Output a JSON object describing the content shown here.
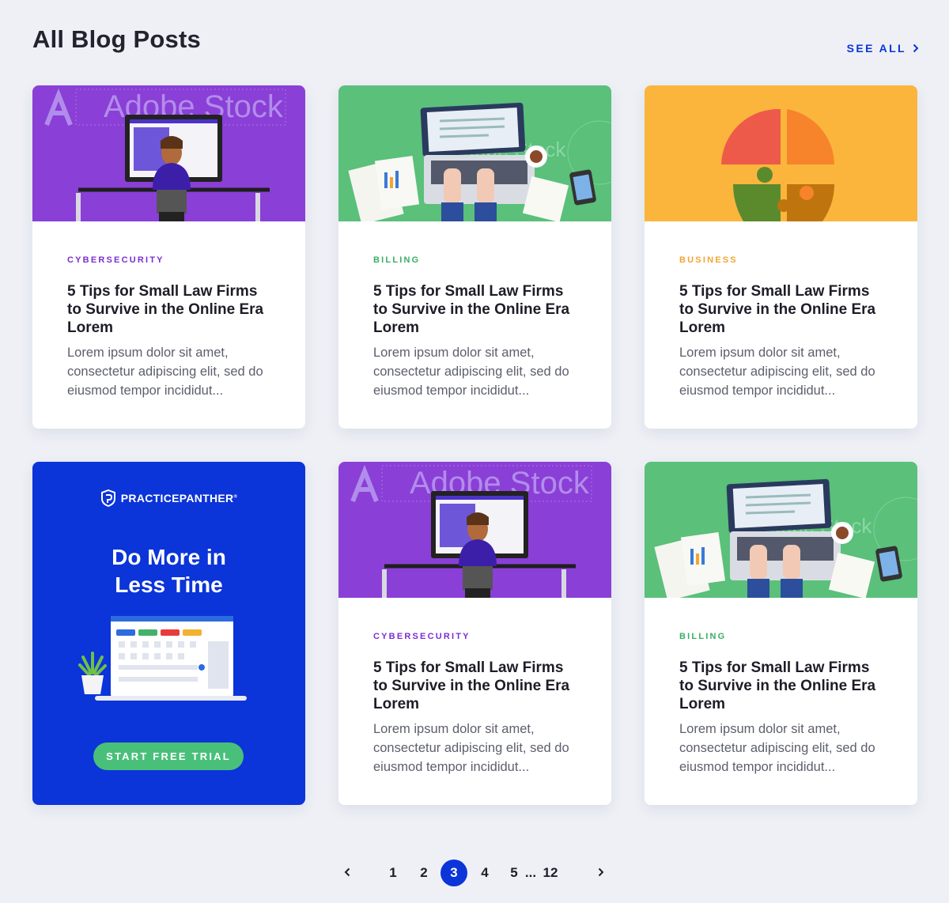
{
  "header": {
    "title": "All Blog Posts",
    "see_all": "SEE ALL"
  },
  "colors": {
    "accent_blue": "#0b34d9",
    "cybersecurity": "#7b2fd0",
    "billing": "#3aaf66",
    "business": "#f2a531",
    "cta_green": "#49c07a"
  },
  "posts": [
    {
      "category": "CYBERSECURITY",
      "title": "5 Tips for Small Law Firms to Survive in the Online Era Lorem",
      "excerpt": "Lorem ipsum dolor sit amet, consectetur adipiscing elit, sed do eiusmod tempor incididut...",
      "image": "person-at-computer-illustration",
      "watermark": "Adobe Stock"
    },
    {
      "category": "BILLING",
      "title": "5 Tips for Small Law Firms to Survive in the Online Era Lorem",
      "excerpt": "Lorem ipsum dolor sit amet, consectetur adipiscing elit, sed do eiusmod tempor incididut...",
      "image": "laptop-desk-illustration",
      "watermark": "Adobe Stock"
    },
    {
      "category": "BUSINESS",
      "title": "5 Tips for Small Law Firms to Survive in the Online Era Lorem",
      "excerpt": "Lorem ipsum dolor sit amet, consectetur adipiscing elit, sed do eiusmod tempor incididut...",
      "image": "puzzle-lightbulb-illustration"
    },
    {
      "category": "CYBERSECURITY",
      "title": "5 Tips for Small Law Firms to Survive in the Online Era Lorem",
      "excerpt": "Lorem ipsum dolor sit amet, consectetur adipiscing elit, sed do eiusmod tempor incididut...",
      "image": "person-at-computer-illustration",
      "watermark": "Adobe Stock"
    },
    {
      "category": "BILLING",
      "title": "5 Tips for Small Law Firms to Survive in the Online Era Lorem",
      "excerpt": "Lorem ipsum dolor sit amet, consectetur adipiscing elit, sed do eiusmod tempor incididut...",
      "image": "laptop-desk-illustration",
      "watermark": "Adobe Stock"
    }
  ],
  "promo": {
    "brand": "PRACTICEPANTHER",
    "brand_mark": "®",
    "headline_line1": "Do More in",
    "headline_line2": "Less Time",
    "cta": "START FREE TRIAL"
  },
  "pagination": {
    "pages": [
      "1",
      "2",
      "3",
      "4",
      "5"
    ],
    "ellipsis": "...",
    "last": "12",
    "current": "3"
  }
}
